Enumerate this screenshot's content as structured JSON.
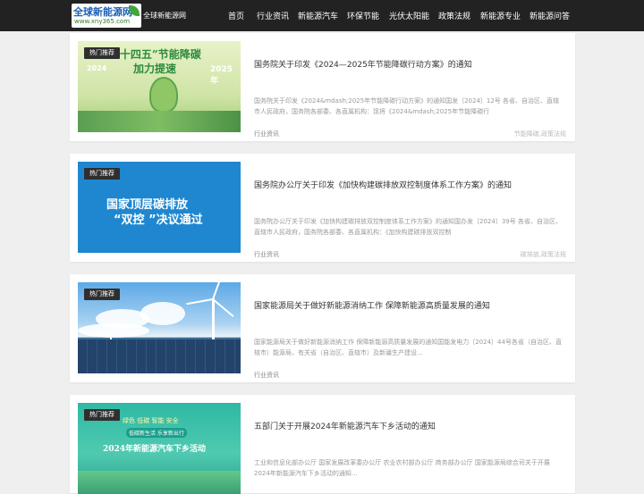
{
  "header": {
    "logo_text": "全球新能源网",
    "logo_url": "www.xny365.com",
    "site_name": "全球新能源网",
    "nav": [
      "首页",
      "行业资讯",
      "新能源汽车",
      "环保节能",
      "光伏太阳能",
      "政策法规",
      "新能源专业",
      "新能源问答"
    ]
  },
  "articles": [
    {
      "tag": "热门推荐",
      "title": "国务院关于印发《2024—2025年节能降碳行动方案》的通知",
      "excerpt": "国务院关于印发《2024&mdash;2025年节能降碳行动方案》的通知国发〔2024〕12号 各省、自治区、直辖市人民政府，国务院各部委、各直属机构：现将《2024&mdash;2025年节能降碳行",
      "category": "行业资讯",
      "tags": "节能降碳,政策法规",
      "image_text": [
        "“十四五”节能降碳",
        "加力提速",
        "2024",
        "2025年"
      ]
    },
    {
      "tag": "热门推荐",
      "title": "国务院办公厅关于印发《加快构建碳排放双控制度体系工作方案》的通知",
      "excerpt": "国务院办公厅关于印发《加快构建碳排放双控制度体系工作方案》的通知国办发〔2024〕39号 各省、自治区、直辖市人民政府，国务院各部委、各直属机构：《加快构建碳排放双控制",
      "category": "行业资讯",
      "tags": "碳排放,政策法规",
      "image_text": [
        "国家顶层碳排放",
        "“双控 ”决议通过"
      ]
    },
    {
      "tag": "热门推荐",
      "title": "国家能源局关于做好新能源消纳工作 保障新能源高质量发展的通知",
      "excerpt": "国家能源局关于做好新能源消纳工作 保障新能源高质量发展的通知国能发电力〔2024〕44号各省（自治区、直辖市）能源局，有关省（自治区、直辖市）及新疆生产建设...",
      "category": "行业资讯",
      "tags": "",
      "image_text": []
    },
    {
      "tag": "热门推荐",
      "title": "五部门关于开展2024年新能源汽车下乡活动的通知",
      "excerpt": "工业和信息化部办公厅 国家发展改革委办公厅 农业农村部办公厅 商务部办公厅 国家能源局综合司关于开展2024年新能源汽车下乡活动的通知...",
      "category": "",
      "tags": "",
      "image_text": [
        "绿色 低碳 智能 安全",
        "低碳新生活 乐享新出行",
        "2024年新能源汽车下乡活动"
      ]
    }
  ]
}
